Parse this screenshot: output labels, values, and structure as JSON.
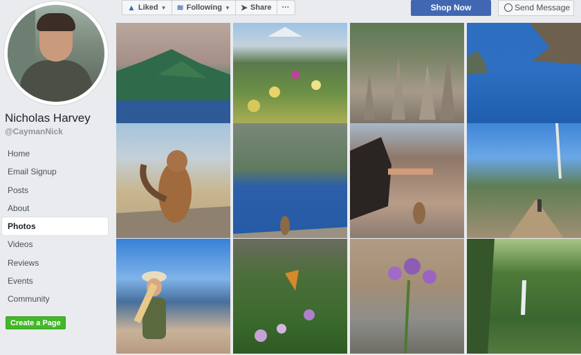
{
  "topbar": {
    "liked_label": "Liked",
    "following_label": "Following",
    "share_label": "Share",
    "more_label": "···",
    "shop_label": "Shop Now",
    "message_label": "Send Message"
  },
  "profile": {
    "name": "Nicholas Harvey",
    "handle": "@CaymanNick"
  },
  "nav": {
    "items": [
      "Home",
      "Email Signup",
      "Posts",
      "About",
      "Photos",
      "Videos",
      "Reviews",
      "Events",
      "Community"
    ],
    "active": "Photos"
  },
  "create_page_label": "Create a Page",
  "colors": {
    "brand_blue": "#4267b2",
    "create_green": "#42b72a",
    "background": "#e9ebee"
  },
  "photos": [
    {
      "subject": "crater-lake-wizard-island"
    },
    {
      "subject": "wildflowers-mountain"
    },
    {
      "subject": "pinnacles-rock-formations"
    },
    {
      "subject": "phantom-ship-lake"
    },
    {
      "subject": "chipmunk-eating"
    },
    {
      "subject": "chipmunk-lake-view"
    },
    {
      "subject": "woman-feeding-chipmunk"
    },
    {
      "subject": "hiker-trail"
    },
    {
      "subject": "woman-crater-lake-overlook"
    },
    {
      "subject": "butterfly-on-asters"
    },
    {
      "subject": "purple-aster-flowers"
    },
    {
      "subject": "waterfall-forest"
    }
  ]
}
